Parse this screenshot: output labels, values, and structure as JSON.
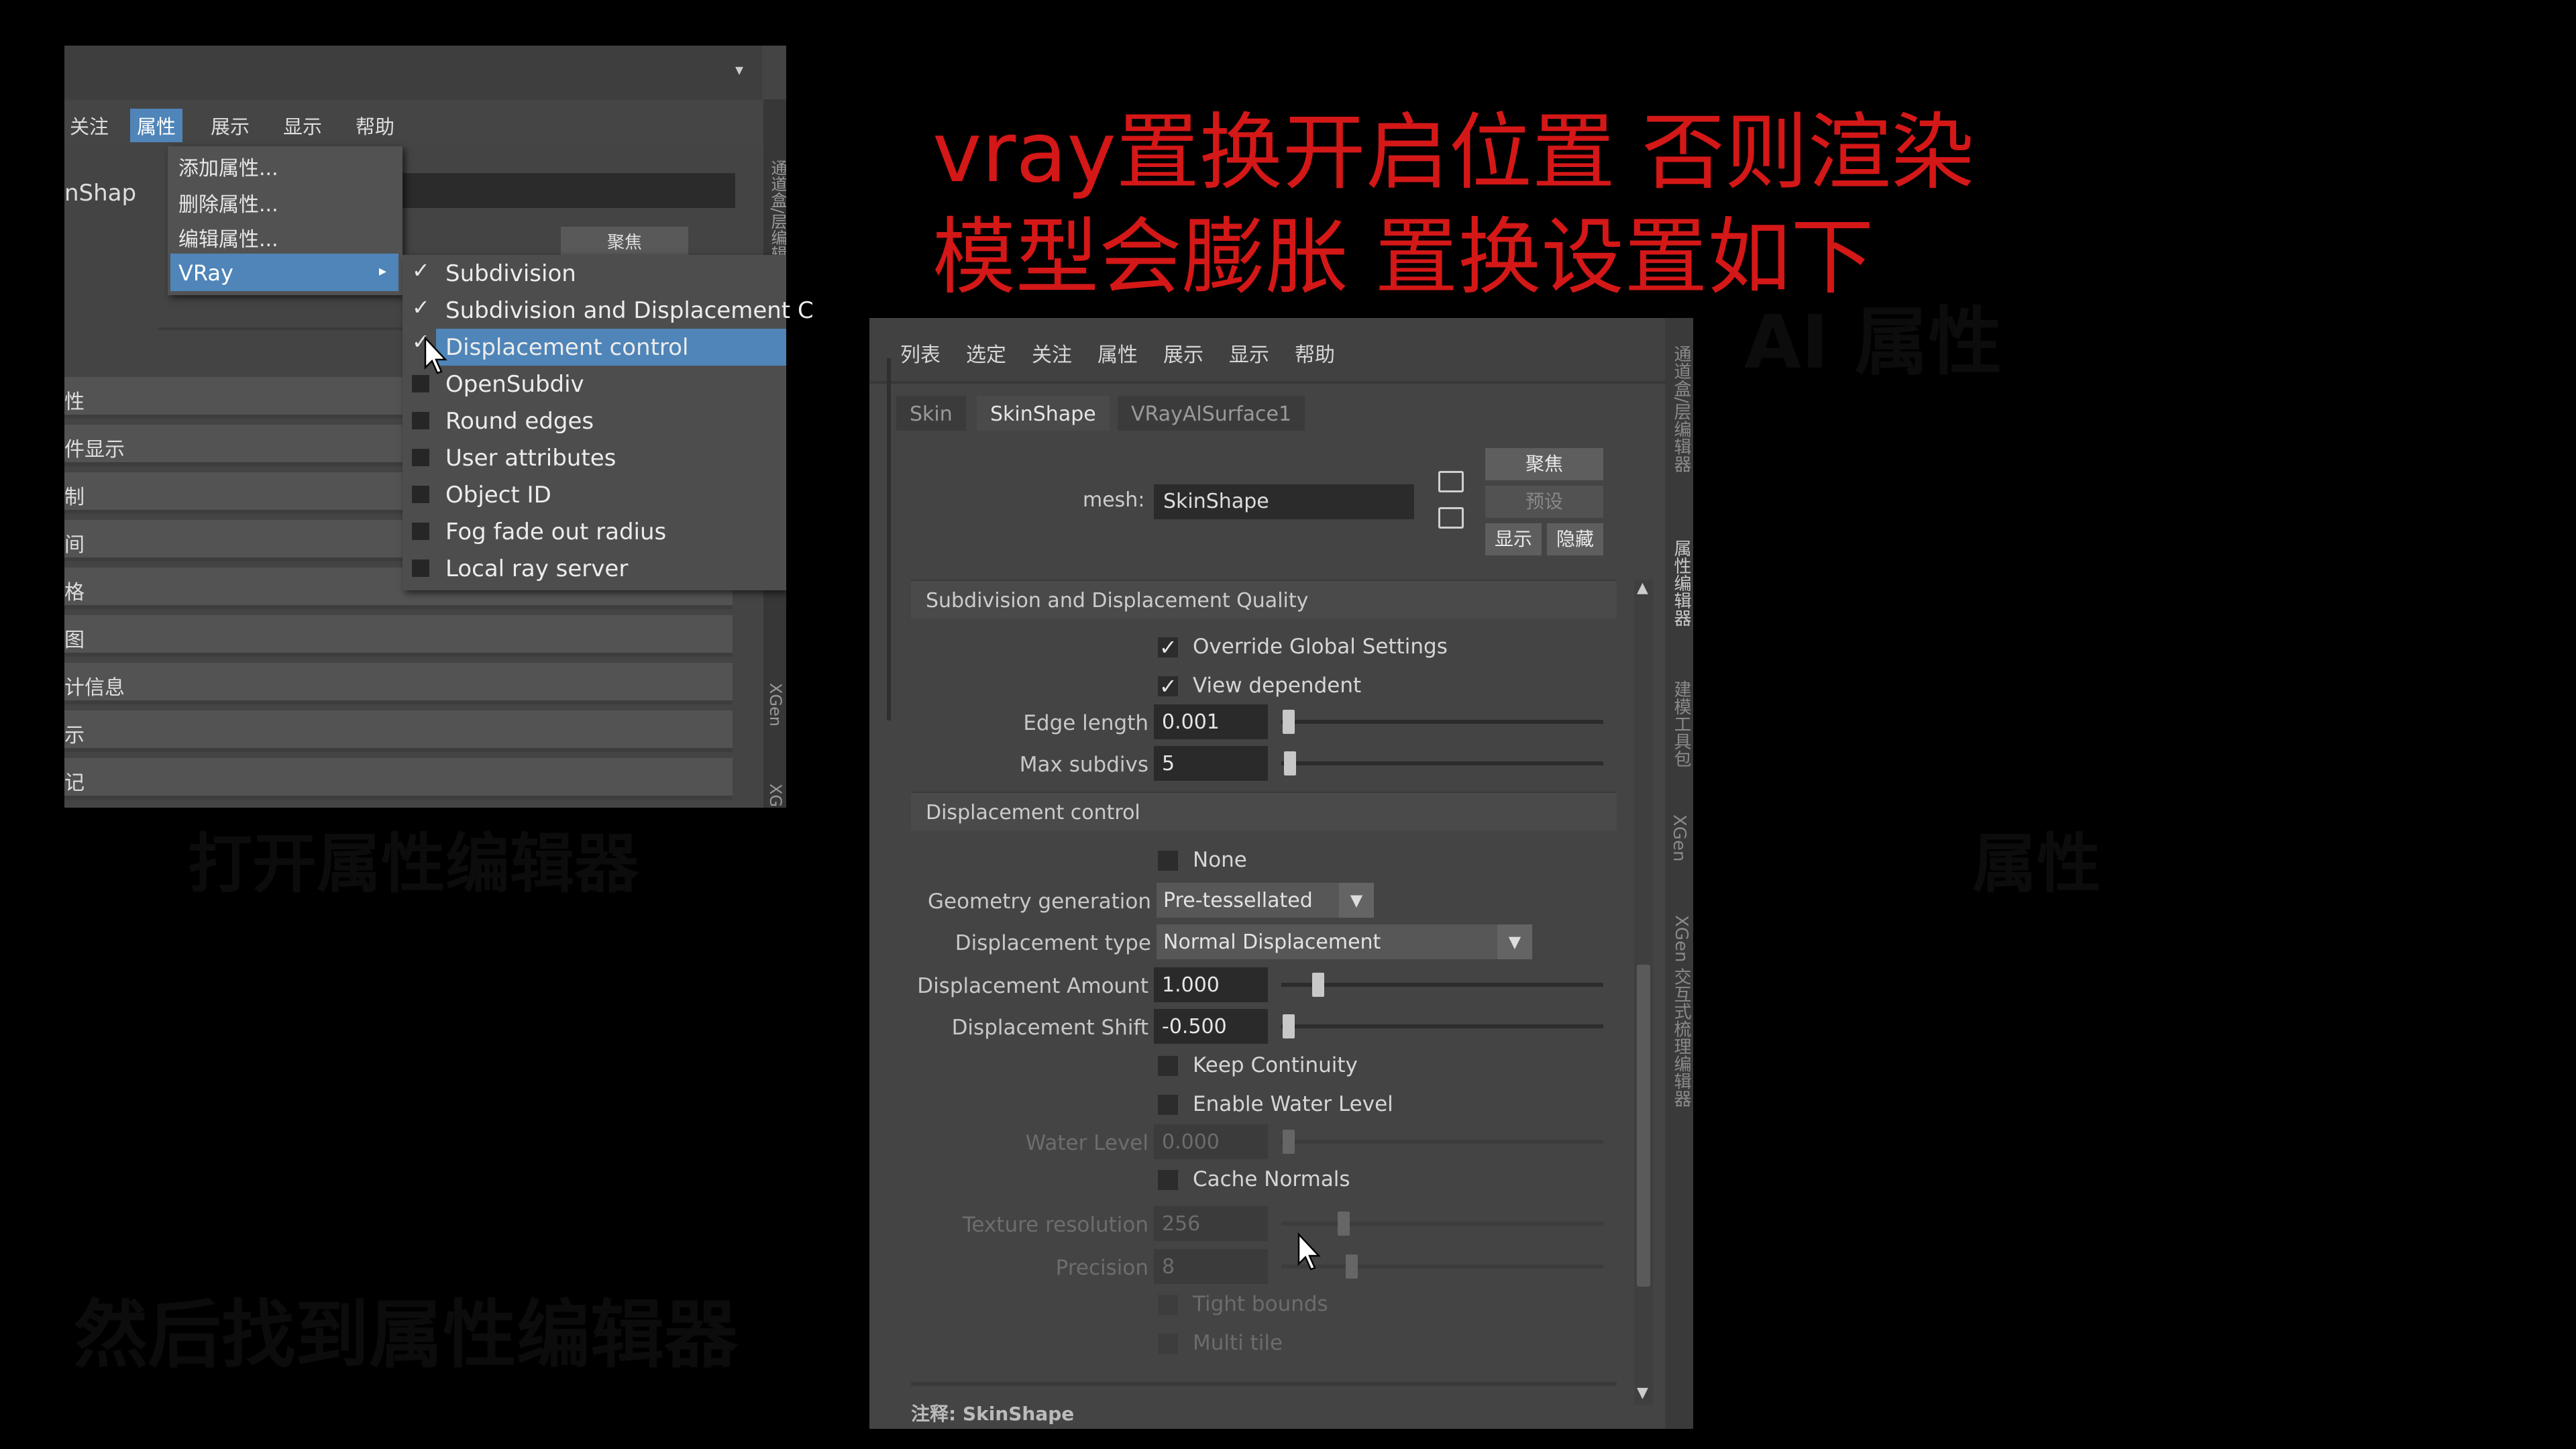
{
  "title": {
    "line1": "vray置换开启位置 否则渲染",
    "line2": "模型会膨胀 置换设置如下"
  },
  "left_panel": {
    "menubar": [
      "关注",
      "属性",
      "展示",
      "显示",
      "帮助"
    ],
    "shape_label": "nShap",
    "focus_button": "聚焦",
    "attr_menu": {
      "items": [
        "添加属性...",
        "删除属性...",
        "编辑属性..."
      ],
      "vray": "VRay"
    },
    "vray_submenu": [
      {
        "label": "Subdivision",
        "checked": true
      },
      {
        "label": "Subdivision and Displacement C",
        "checked": true
      },
      {
        "label": "Displacement control",
        "checked": true
      },
      {
        "label": "OpenSubdiv",
        "checked": false
      },
      {
        "label": "Round edges",
        "checked": false
      },
      {
        "label": "User attributes",
        "checked": false
      },
      {
        "label": "Object ID",
        "checked": false
      },
      {
        "label": "Fog fade out radius",
        "checked": false
      },
      {
        "label": "Local ray server",
        "checked": false
      }
    ],
    "sections": [
      "性",
      "件显示",
      "制",
      "间",
      "格",
      "图",
      "计信息",
      "示",
      "记"
    ],
    "sidebar": [
      "通道盒/层编辑",
      "XGen",
      "XGen"
    ]
  },
  "right_panel": {
    "menubar": [
      "列表",
      "选定",
      "关注",
      "属性",
      "展示",
      "显示",
      "帮助"
    ],
    "tabs": [
      "Skin",
      "SkinShape",
      "VRayAlSurface1"
    ],
    "mesh_label": "mesh:",
    "mesh_value": "SkinShape",
    "buttons": {
      "focus": "聚焦",
      "preset": "预设",
      "show": "显示",
      "hide": "隐藏"
    },
    "sidebar": [
      "通道盒/层编辑器",
      "属性编辑器",
      "建模工具包",
      "XGen",
      "XGen 交互式梳理编辑器"
    ],
    "quality": {
      "header": "Subdivision and Displacement Quality",
      "override": "Override Global Settings",
      "view_dependent": "View dependent",
      "edge_length_label": "Edge length",
      "edge_length": "0.001",
      "max_subdivs_label": "Max subdivs",
      "max_subdivs": "5"
    },
    "displacement": {
      "header": "Displacement control",
      "none": "None",
      "geom_label": "Geometry generation",
      "geom_value": "Pre-tessellated",
      "type_label": "Displacement type",
      "type_value": "Normal Displacement",
      "amount_label": "Displacement Amount",
      "amount": "1.000",
      "shift_label": "Displacement Shift",
      "shift": "-0.500",
      "keep_continuity": "Keep Continuity",
      "enable_water": "Enable Water Level",
      "water_label": "Water Level",
      "water": "0.000",
      "cache_normals": "Cache Normals",
      "tex_res_label": "Texture resolution",
      "tex_res": "256",
      "precision_label": "Precision",
      "precision": "8",
      "tight_bounds": "Tight bounds",
      "multi_tile": "Multi tile"
    },
    "footer": "注释: SkinShape"
  },
  "ghost_text": {
    "a": "打开属性编辑器",
    "b": "AI 属性",
    "c": "属性",
    "d": "然后找到属性编辑器"
  },
  "colors": {
    "title_red": "#d41717",
    "select_blue": "#4f85b8",
    "panel": "#444444"
  }
}
